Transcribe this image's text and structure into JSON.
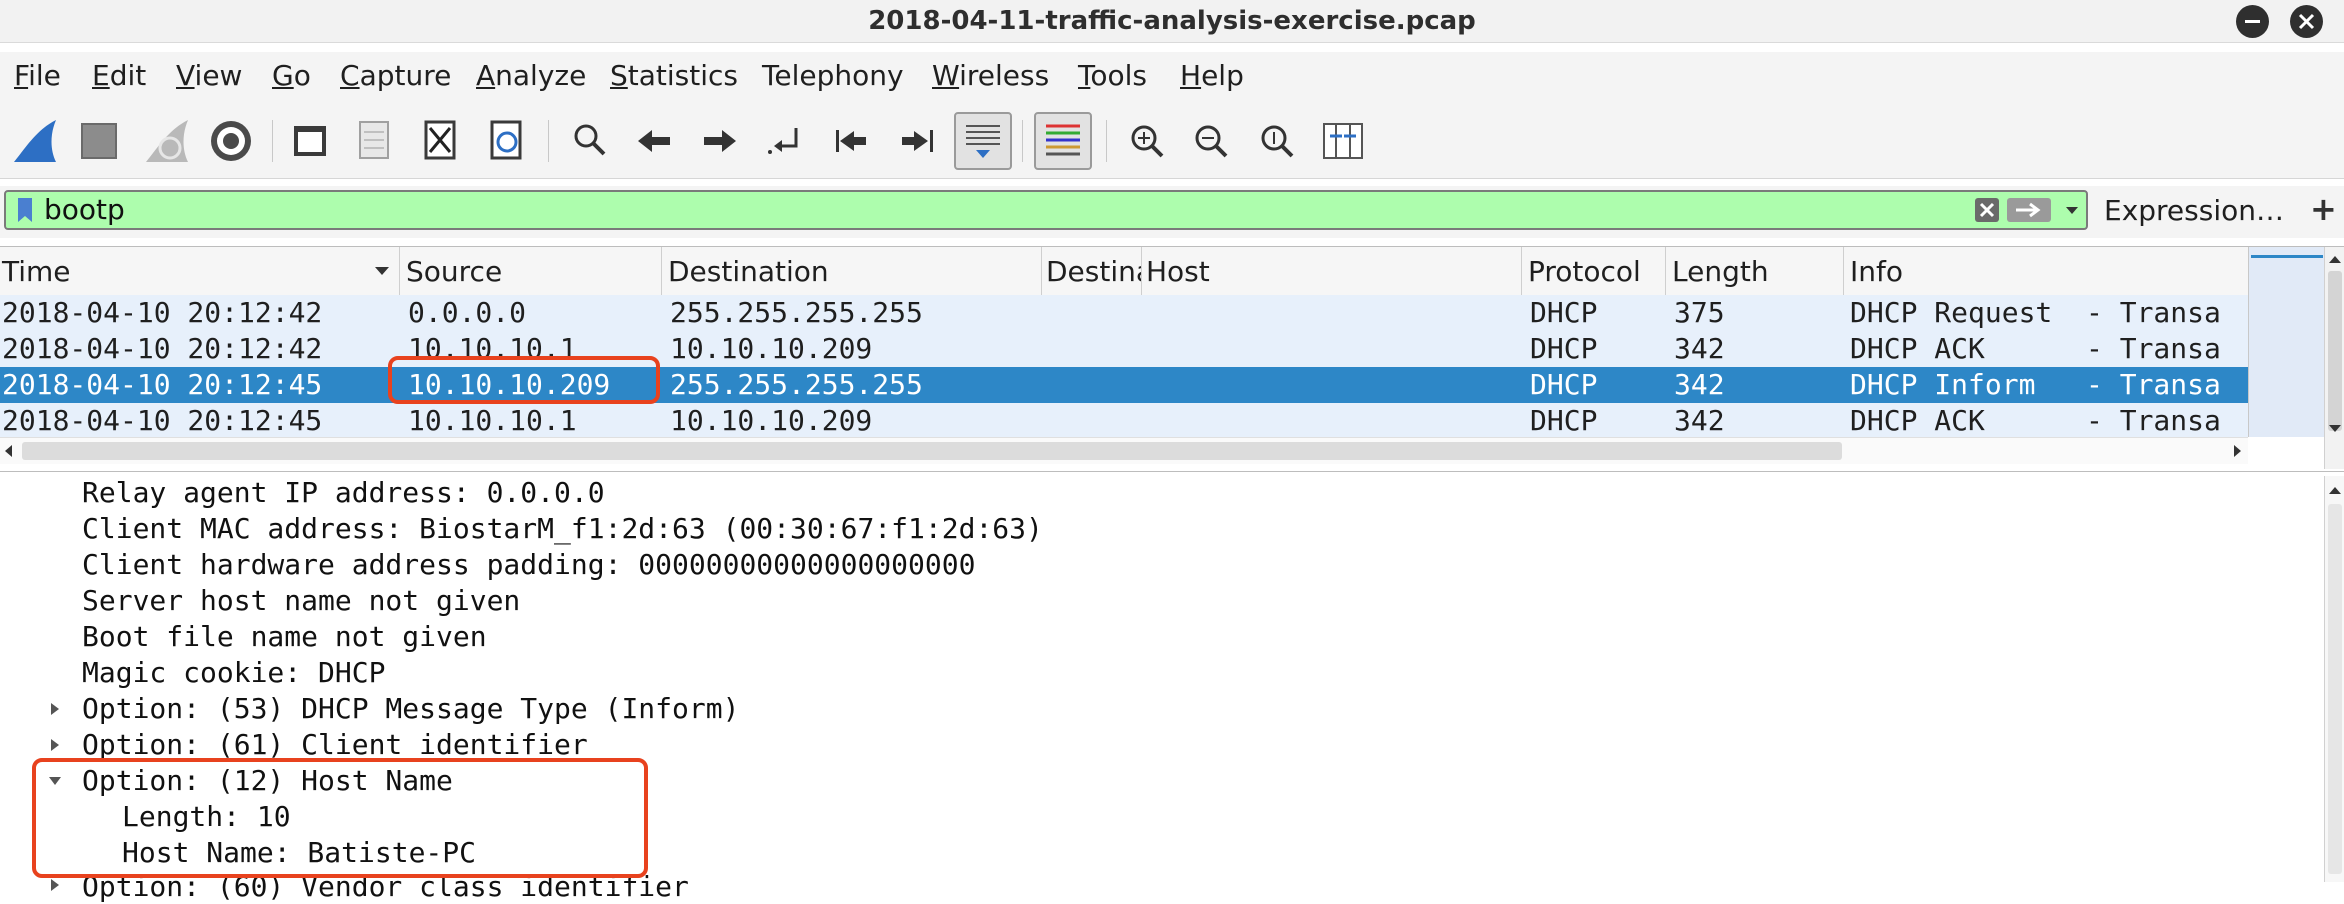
{
  "window": {
    "title": "2018-04-11-traffic-analysis-exercise.pcap"
  },
  "menu": [
    {
      "label": "File",
      "u": "F",
      "rest": "ile"
    },
    {
      "label": "Edit",
      "u": "E",
      "rest": "dit"
    },
    {
      "label": "View",
      "u": "V",
      "rest": "iew"
    },
    {
      "label": "Go",
      "u": "G",
      "rest": "o"
    },
    {
      "label": "Capture",
      "u": "C",
      "rest": "apture"
    },
    {
      "label": "Analyze",
      "u": "A",
      "rest": "nalyze"
    },
    {
      "label": "Statistics",
      "u": "S",
      "rest": "tatistics"
    },
    {
      "label": "Telephony",
      "u": "",
      "rest": "Telephony"
    },
    {
      "label": "Wireless",
      "u": "W",
      "rest": "ireless"
    },
    {
      "label": "Tools",
      "u": "T",
      "rest": "ools"
    },
    {
      "label": "Help",
      "u": "H",
      "rest": "elp"
    }
  ],
  "filter": {
    "value": "bootp",
    "expression_label": "Expression…",
    "add_label": "+"
  },
  "packet_list": {
    "columns": [
      "Time",
      "Source",
      "Destination",
      "Destina",
      "Host",
      "Protocol",
      "Length",
      "Info"
    ],
    "rows": [
      {
        "time": "2018-04-10 20:12:42",
        "source": "0.0.0.0",
        "destination": "255.255.255.255",
        "dest2": "",
        "host": "",
        "protocol": "DHCP",
        "length": "375",
        "info": "DHCP Request  - Transa"
      },
      {
        "time": "2018-04-10 20:12:42",
        "source": "10.10.10.1",
        "destination": "10.10.10.209",
        "dest2": "",
        "host": "",
        "protocol": "DHCP",
        "length": "342",
        "info": "DHCP ACK      - Transa"
      },
      {
        "time": "2018-04-10 20:12:45",
        "source": "10.10.10.209",
        "destination": "255.255.255.255",
        "dest2": "",
        "host": "",
        "protocol": "DHCP",
        "length": "342",
        "info": "DHCP Inform   - Transa"
      },
      {
        "time": "2018-04-10 20:12:45",
        "source": "10.10.10.1",
        "destination": "10.10.10.209",
        "dest2": "",
        "host": "",
        "protocol": "DHCP",
        "length": "342",
        "info": "DHCP ACK      - Transa"
      }
    ],
    "selected_row": 2
  },
  "details": {
    "lines": [
      {
        "text": "Relay agent IP address: 0.0.0.0",
        "indent": 0,
        "expander": "none"
      },
      {
        "text": "Client MAC address: BiostarM_f1:2d:63 (00:30:67:f1:2d:63)",
        "indent": 0,
        "expander": "none"
      },
      {
        "text": "Client hardware address padding: 00000000000000000000",
        "indent": 0,
        "expander": "none"
      },
      {
        "text": "Server host name not given",
        "indent": 0,
        "expander": "none"
      },
      {
        "text": "Boot file name not given",
        "indent": 0,
        "expander": "none"
      },
      {
        "text": "Magic cookie: DHCP",
        "indent": 0,
        "expander": "none"
      },
      {
        "text": "Option: (53) DHCP Message Type (Inform)",
        "indent": 0,
        "expander": "collapsed"
      },
      {
        "text": "Option: (61) Client identifier",
        "indent": 0,
        "expander": "collapsed"
      },
      {
        "text": "Option: (12) Host Name",
        "indent": 0,
        "expander": "expanded"
      },
      {
        "text": "Length: 10",
        "indent": 1,
        "expander": "none"
      },
      {
        "text": "Host Name: Batiste-PC",
        "indent": 1,
        "expander": "none"
      },
      {
        "text": "Option: (60) Vendor class identifier",
        "indent": 0,
        "expander": "collapsed"
      }
    ]
  },
  "colors": {
    "filter_valid_bg": "#adfdad",
    "selected_row_bg": "#2d87c7",
    "row_bg": "#e7f0fb",
    "highlight": "#e8421e"
  }
}
